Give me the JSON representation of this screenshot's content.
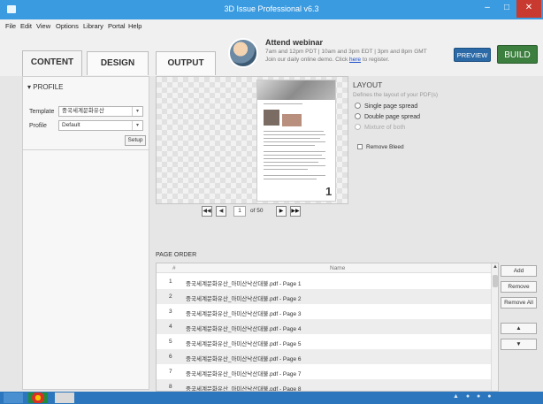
{
  "window": {
    "title": "3D Issue Professional v6.3"
  },
  "menu": [
    "File",
    "Edit",
    "View",
    "Options",
    "Library",
    "Portal",
    "Help"
  ],
  "tabs": [
    {
      "label": "CONTENT",
      "active": true
    },
    {
      "label": "DESIGN",
      "active": false
    },
    {
      "label": "OUTPUT",
      "active": false
    }
  ],
  "webinar": {
    "title": "Attend webinar",
    "line1": "7am and 12pm PDT | 10am and 3pm EDT | 3pm and 8pm GMT",
    "line2_pre": "Join our daily online demo. Click ",
    "line2_link": "here",
    "line2_post": " to register."
  },
  "buttons": {
    "preview": "PREVIEW",
    "build": "BUILD"
  },
  "profile": {
    "section": "PROFILE",
    "template_label": "Template",
    "template_value": "중국세계문화유산",
    "profile_label": "Profile",
    "profile_value": "Default",
    "setup": "Setup"
  },
  "pager": {
    "current": "1",
    "total": "of 50"
  },
  "layout": {
    "title": "LAYOUT",
    "description": "Defines the layout of your PDF(s)",
    "options": [
      "Single page spread",
      "Double page spread",
      "Mixture of both"
    ],
    "remove_bleed": "Remove Bleed"
  },
  "page_order": {
    "label": "PAGE ORDER",
    "col_num": "#",
    "col_name": "Name",
    "rows": [
      {
        "num": "1",
        "name": "중국세계문화유산_아미산낙산대불.pdf - Page 1"
      },
      {
        "num": "2",
        "name": "중국세계문화유산_아미산낙산대불.pdf - Page 2"
      },
      {
        "num": "3",
        "name": "중국세계문화유산_아미산낙산대불.pdf - Page 3"
      },
      {
        "num": "4",
        "name": "중국세계문화유산_아미산낙산대불.pdf - Page 4"
      },
      {
        "num": "5",
        "name": "중국세계문화유산_아미산낙산대불.pdf - Page 5"
      },
      {
        "num": "6",
        "name": "중국세계문화유산_아미산낙산대불.pdf - Page 6"
      },
      {
        "num": "7",
        "name": "중국세계문화유산_아미산낙산대불.pdf - Page 7"
      },
      {
        "num": "8",
        "name": "중국세계문화유산_아미산낙산대불.pdf - Page 8"
      }
    ],
    "add": "Add",
    "remove": "Remove",
    "remove_all": "Remove All"
  },
  "colors": {
    "titlebar": "#3b9be0",
    "build": "#3c7f3e",
    "preview": "#2b6aa6",
    "taskbar": "#2b76bd"
  }
}
